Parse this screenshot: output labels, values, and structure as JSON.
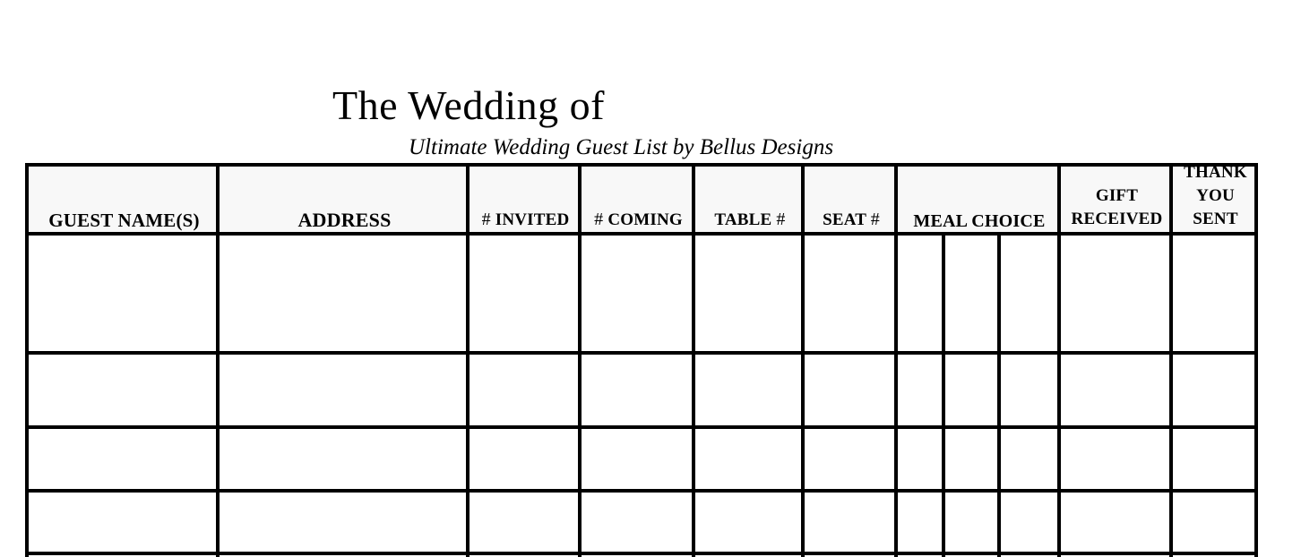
{
  "document": {
    "title": "The Wedding of",
    "subtitle": "Ultimate Wedding Guest List by Bellus Designs"
  },
  "table": {
    "columns": [
      {
        "key": "guest_names",
        "label": "GUEST NAME(S)"
      },
      {
        "key": "address",
        "label": "ADDRESS"
      },
      {
        "key": "invited",
        "prefix": "#",
        "label": "INVITED"
      },
      {
        "key": "coming",
        "prefix": "#",
        "label": "COMING"
      },
      {
        "key": "table",
        "label": "TABLE",
        "suffix": "#"
      },
      {
        "key": "seat",
        "label": "SEAT",
        "suffix": "#"
      },
      {
        "key": "meal_choice",
        "label": "MEAL CHOICE",
        "subcolumns": 3
      },
      {
        "key": "gift_received",
        "label_line1": "GIFT",
        "label_line2": "RECEIVED"
      },
      {
        "key": "thank_you_sent",
        "label_line1": "THANK",
        "label_line2": "YOU",
        "label_line3": "SENT"
      }
    ],
    "rows": [
      {
        "guest_names": "",
        "address": "",
        "invited": "",
        "coming": "",
        "table": "",
        "seat": "",
        "meal_1": "",
        "meal_2": "",
        "meal_3": "",
        "gift_received": "",
        "thank_you_sent": ""
      },
      {
        "guest_names": "",
        "address": "",
        "invited": "",
        "coming": "",
        "table": "",
        "seat": "",
        "meal_1": "",
        "meal_2": "",
        "meal_3": "",
        "gift_received": "",
        "thank_you_sent": ""
      },
      {
        "guest_names": "",
        "address": "",
        "invited": "",
        "coming": "",
        "table": "",
        "seat": "",
        "meal_1": "",
        "meal_2": "",
        "meal_3": "",
        "gift_received": "",
        "thank_you_sent": ""
      },
      {
        "guest_names": "",
        "address": "",
        "invited": "",
        "coming": "",
        "table": "",
        "seat": "",
        "meal_1": "",
        "meal_2": "",
        "meal_3": "",
        "gift_received": "",
        "thank_you_sent": ""
      }
    ]
  }
}
